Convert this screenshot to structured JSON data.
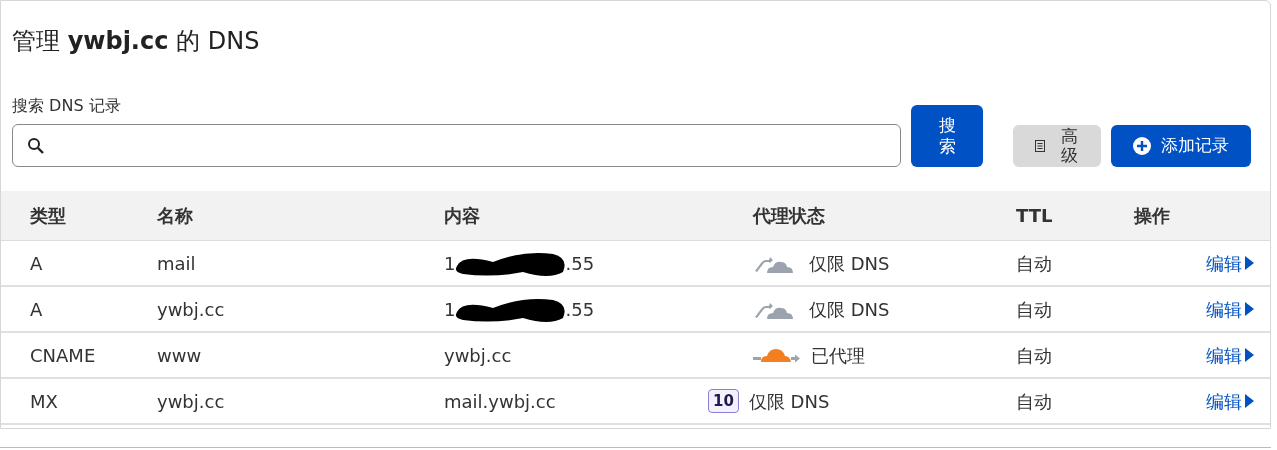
{
  "title": "管理 **ywbj.cc** 的 DNS",
  "search": {
    "label": "搜索 DNS 记录",
    "button": "搜索"
  },
  "advanced_button": "高级",
  "add_button": "添加记录",
  "table": {
    "columns": [
      "类型",
      "名称",
      "内容",
      "代理状态",
      "TTL",
      "操作"
    ],
    "rows": [
      {
        "type": "A",
        "name": "mail",
        "content": "1",
        "content_tail": ".55",
        "redacted": true,
        "kind": "dns_only",
        "proxy": "仅限 DNS",
        "ttl": "自动",
        "action": "编辑"
      },
      {
        "type": "A",
        "name": "ywbj.cc",
        "content": "1",
        "content_tail": ".55",
        "redacted": true,
        "kind": "dns_only",
        "proxy": "仅限 DNS",
        "ttl": "自动",
        "action": "编辑"
      },
      {
        "type": "CNAME",
        "name": "www",
        "content": "ywbj.cc",
        "redacted": false,
        "kind": "proxied",
        "proxy": "已代理",
        "ttl": "自动",
        "action": "编辑"
      },
      {
        "type": "MX",
        "name": "ywbj.cc",
        "content": "mail.ywbj.cc",
        "redacted": false,
        "kind": "priority",
        "priority": "10",
        "proxy": "仅限 DNS",
        "ttl": "自动",
        "action": "编辑"
      }
    ]
  }
}
